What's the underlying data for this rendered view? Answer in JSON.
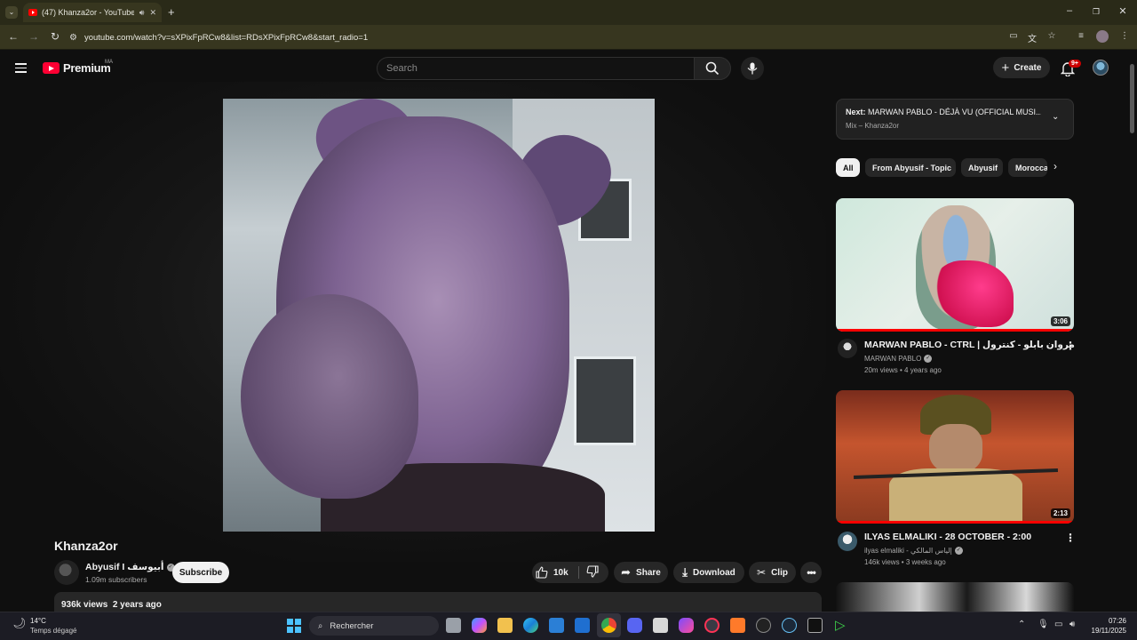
{
  "browser": {
    "tab_title": "(47) Khanza2or - YouTube",
    "url": "youtube.com/watch?v=sXPixFpRCw8&list=RDsXPixFpRCw8&start_radio=1"
  },
  "header": {
    "logo_text": "Premium",
    "country_code": "MA",
    "search_placeholder": "Search",
    "create_label": "Create",
    "notification_count": "9+"
  },
  "video": {
    "title": "Khanza2or",
    "channel_name": "Abyusif I أبيوسف",
    "subscribers": "1.09m subscribers",
    "subscribe_label": "Subscribe",
    "likes": "10k",
    "share_label": "Share",
    "download_label": "Download",
    "clip_label": "Clip",
    "views": "936k views",
    "age": "2 years ago"
  },
  "playlist": {
    "next_prefix": "Next:",
    "next_title": "MARWAN PABLO - DÉJÀ VU (OFFICIAL MUSI...",
    "mix_label": "Mix – Khanza2or"
  },
  "chips": [
    "All",
    "From Abyusif - Topic",
    "Abyusif",
    "Moroccan"
  ],
  "recommendations": [
    {
      "title": "MARWAN PABLO - CTRL | مروان بابلو - كنترول",
      "channel": "MARWAN PABLO",
      "views": "20m views",
      "age": "4 years ago",
      "duration": "3:06"
    },
    {
      "title": "ILYAS ELMALIKI - 28 OCTOBER - 2:00",
      "channel": "ilyas elmaliki - إلياس المالكي",
      "views": "146k views",
      "age": "3 weeks ago",
      "duration": "2:13"
    }
  ],
  "taskbar": {
    "temperature": "14°C",
    "weather": "Temps dégagé",
    "search_label": "Rechercher",
    "time": "07:26",
    "date": "19/11/2025"
  },
  "colors": {
    "yt_red": "#ff0033",
    "background": "#0f0f0f",
    "chrome_bar": "#37361f"
  }
}
